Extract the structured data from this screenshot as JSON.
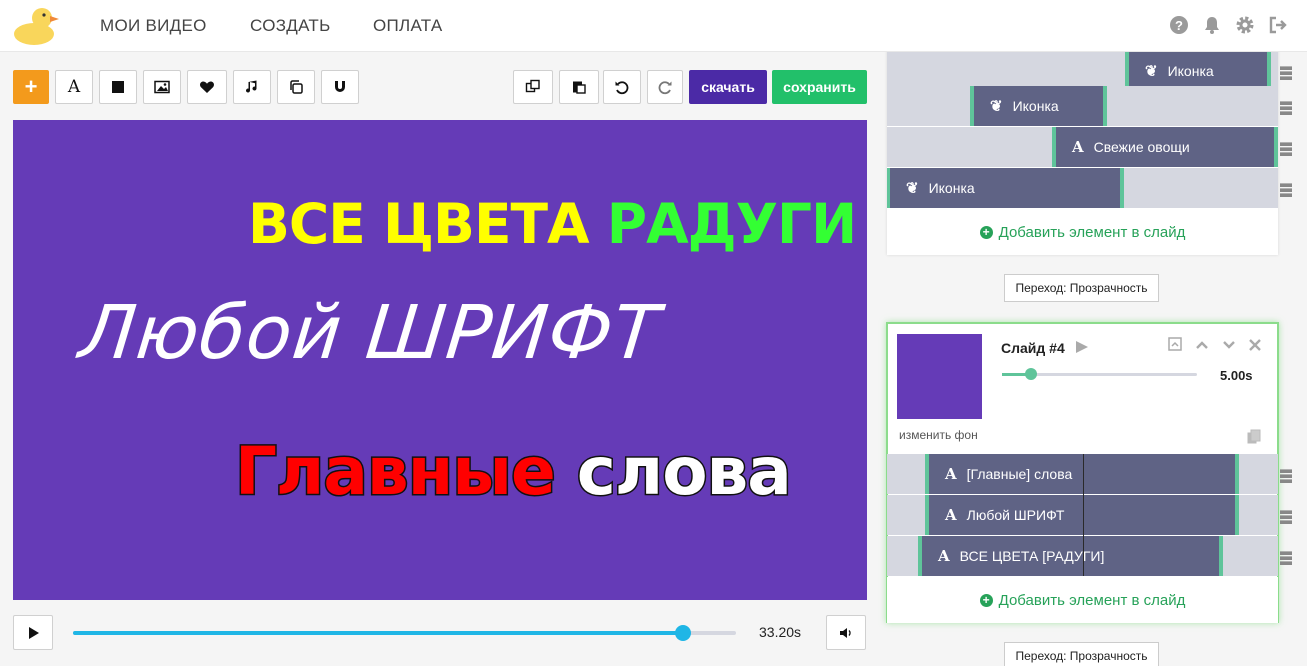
{
  "nav": {
    "my_videos": "МОИ ВИДЕО",
    "create": "СОЗДАТЬ",
    "payment": "ОПЛАТА"
  },
  "top_icons": [
    "help-icon",
    "bell-icon",
    "gear-icon",
    "logout-icon"
  ],
  "toolbar": {
    "download": "скачать",
    "save": "сохранить",
    "text_tool": "A"
  },
  "canvas": {
    "background": "#653bb7",
    "line1_a": "ВСЕ ЦВЕТА",
    "line1_b": "РАДУГИ",
    "line2": "Любой ШРИФТ",
    "line3_a": "Главные",
    "line3_b": "слова"
  },
  "player": {
    "time": "33.20s",
    "progress": 0.92
  },
  "prev_slide": {
    "elements": [
      {
        "icon": "leaf-icon",
        "label": "Иконка"
      },
      {
        "icon": "leaf-icon",
        "label": "Иконка"
      },
      {
        "icon": "A",
        "label": "Свежие овощи"
      },
      {
        "icon": "leaf-icon",
        "label": "Иконка"
      }
    ],
    "add": "Добавить элемент в слайд",
    "transition": "Переход: Прозрачность"
  },
  "slide4": {
    "title": "Слайд #4",
    "duration": "5.00s",
    "change_bg": "изменить фон",
    "elements": [
      {
        "icon": "A",
        "label": "[Главные] слова"
      },
      {
        "icon": "A",
        "label": "Любой ШРИФТ"
      },
      {
        "icon": "A",
        "label": "ВСЕ ЦВЕТА [РАДУГИ]"
      }
    ],
    "add": "Добавить элемент в слайд",
    "transition": "Переход: Прозрачность"
  },
  "colors": {
    "accent_orange": "#f39a1c",
    "download": "#4b2aa6",
    "save": "#22c06a",
    "slider": "#1fb6e6",
    "active_border": "#8bdc8b"
  }
}
